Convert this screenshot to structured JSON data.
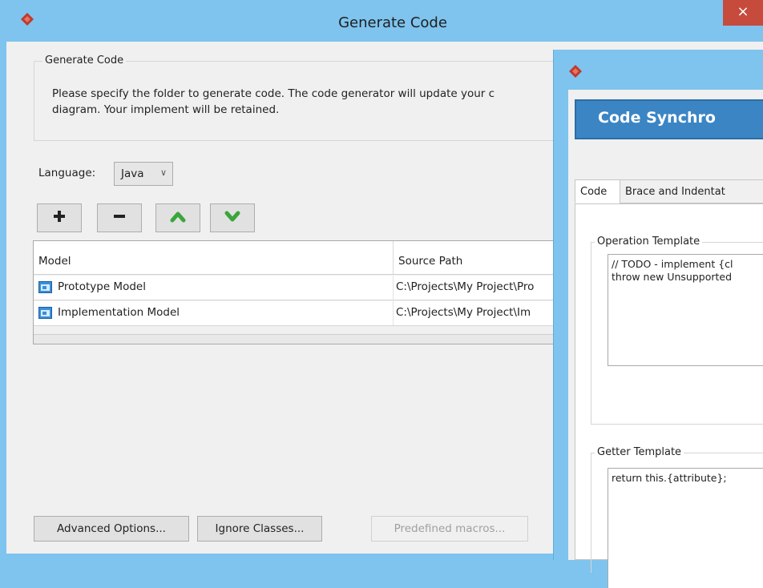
{
  "main_window": {
    "title": "Generate Code",
    "close_glyph": "×",
    "generate_group": {
      "legend": "Generate Code",
      "description_line1": "Please specify the folder to generate code. The code generator will update your c",
      "description_line2": "diagram. Your implement will be retained."
    },
    "language": {
      "label": "Language:",
      "value": "Java"
    },
    "toolbar": {
      "icons": [
        "plus-icon",
        "minus-icon",
        "arrow-up-icon",
        "arrow-down-icon"
      ]
    },
    "table": {
      "columns": [
        "Model",
        "Source Path"
      ],
      "rows": [
        {
          "model": "Prototype Model",
          "path": "C:\\Projects\\My Project\\Pro"
        },
        {
          "model": "Implementation Model",
          "path": "C:\\Projects\\My Project\\Im"
        }
      ]
    },
    "buttons": {
      "advanced": "Advanced Options...",
      "ignore": "Ignore Classes...",
      "macros": "Predefined macros..."
    }
  },
  "sync_window": {
    "banner": "Code Synchro",
    "tabs": [
      "Code",
      "Brace and Indentat"
    ],
    "operation_template": {
      "legend": "Operation Template",
      "text": "// TODO - implement {cl\nthrow new Unsupported"
    },
    "getter_template": {
      "legend": "Getter Template",
      "text": "return this.{attribute};"
    }
  },
  "colors": {
    "title_bar": "#7ec4ee",
    "close_button": "#c74b3d",
    "banner": "#3b85c4",
    "arrow_green": "#3aa63a"
  }
}
